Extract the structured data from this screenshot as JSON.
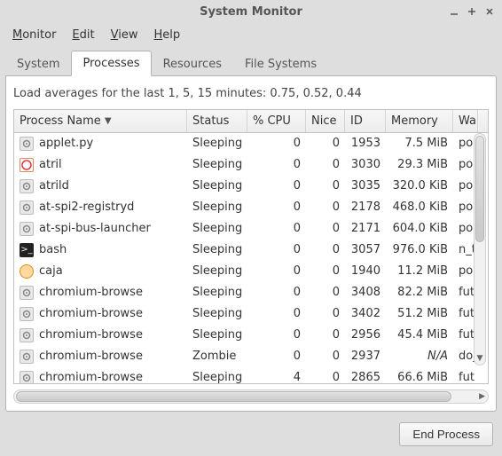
{
  "window": {
    "title": "System Monitor"
  },
  "menubar": [
    {
      "label": "Monitor",
      "accel": "M"
    },
    {
      "label": "Edit",
      "accel": "E"
    },
    {
      "label": "View",
      "accel": "V"
    },
    {
      "label": "Help",
      "accel": "H"
    }
  ],
  "tabs": [
    {
      "label": "System"
    },
    {
      "label": "Processes",
      "active": true
    },
    {
      "label": "Resources"
    },
    {
      "label": "File Systems"
    }
  ],
  "loadavg_text": "Load averages for the last 1, 5, 15 minutes: 0.75, 0.52, 0.44",
  "columns": [
    {
      "label": "Process Name",
      "sorted": true
    },
    {
      "label": "Status"
    },
    {
      "label": "% CPU"
    },
    {
      "label": "Nice"
    },
    {
      "label": "ID"
    },
    {
      "label": "Memory"
    },
    {
      "label": "Wa"
    }
  ],
  "processes": [
    {
      "icon": "gear",
      "name": "applet.py",
      "status": "Sleeping",
      "cpu": "0",
      "nice": "0",
      "id": "1953",
      "memory": "7.5 MiB",
      "wa": "pol"
    },
    {
      "icon": "doc",
      "name": "atril",
      "status": "Sleeping",
      "cpu": "0",
      "nice": "0",
      "id": "3030",
      "memory": "29.3 MiB",
      "wa": "pol"
    },
    {
      "icon": "gear",
      "name": "atrild",
      "status": "Sleeping",
      "cpu": "0",
      "nice": "0",
      "id": "3035",
      "memory": "320.0 KiB",
      "wa": "pol"
    },
    {
      "icon": "gear",
      "name": "at-spi2-registryd",
      "status": "Sleeping",
      "cpu": "0",
      "nice": "0",
      "id": "2178",
      "memory": "468.0 KiB",
      "wa": "pol"
    },
    {
      "icon": "gear",
      "name": "at-spi-bus-launcher",
      "status": "Sleeping",
      "cpu": "0",
      "nice": "0",
      "id": "2171",
      "memory": "604.0 KiB",
      "wa": "pol"
    },
    {
      "icon": "term",
      "name": "bash",
      "status": "Sleeping",
      "cpu": "0",
      "nice": "0",
      "id": "3057",
      "memory": "976.0 KiB",
      "wa": "n_t"
    },
    {
      "icon": "caja",
      "name": "caja",
      "status": "Sleeping",
      "cpu": "0",
      "nice": "0",
      "id": "1940",
      "memory": "11.2 MiB",
      "wa": "pol"
    },
    {
      "icon": "gear",
      "name": "chromium-browse",
      "status": "Sleeping",
      "cpu": "0",
      "nice": "0",
      "id": "3408",
      "memory": "82.2 MiB",
      "wa": "fut"
    },
    {
      "icon": "gear",
      "name": "chromium-browse",
      "status": "Sleeping",
      "cpu": "0",
      "nice": "0",
      "id": "3402",
      "memory": "51.2 MiB",
      "wa": "fut"
    },
    {
      "icon": "gear",
      "name": "chromium-browse",
      "status": "Sleeping",
      "cpu": "0",
      "nice": "0",
      "id": "2956",
      "memory": "45.4 MiB",
      "wa": "fut"
    },
    {
      "icon": "gear",
      "name": "chromium-browse",
      "status": "Zombie",
      "cpu": "0",
      "nice": "0",
      "id": "2937",
      "memory": "N/A",
      "wa": "do_"
    },
    {
      "icon": "gear",
      "name": "chromium-browse",
      "status": "Sleeping",
      "cpu": "4",
      "nice": "0",
      "id": "2865",
      "memory": "66.6 MiB",
      "wa": "fut"
    }
  ],
  "footer": {
    "end_process": "End Process"
  }
}
